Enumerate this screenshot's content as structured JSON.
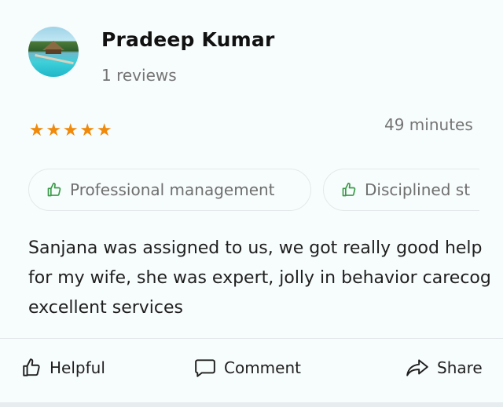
{
  "review": {
    "author": "Pradeep Kumar",
    "reviews_count": "1 reviews",
    "rating": 5,
    "stars": [
      "★",
      "★",
      "★",
      "★",
      "★"
    ],
    "time": "49 minutes",
    "tags": [
      {
        "label": "Professional management",
        "icon": "thumbs-up-icon"
      },
      {
        "label": "Disciplined st",
        "icon": "thumbs-up-icon"
      }
    ],
    "text": "Sanjana was assigned to us, we got really good help for my wife, she was expert, jolly in behavior carecog excellent services"
  },
  "actions": {
    "helpful": "Helpful",
    "comment": "Comment",
    "share": "Share"
  },
  "colors": {
    "star": "#f08a0b",
    "tag_icon": "#3a9a4a",
    "background": "#f7fcfc"
  }
}
